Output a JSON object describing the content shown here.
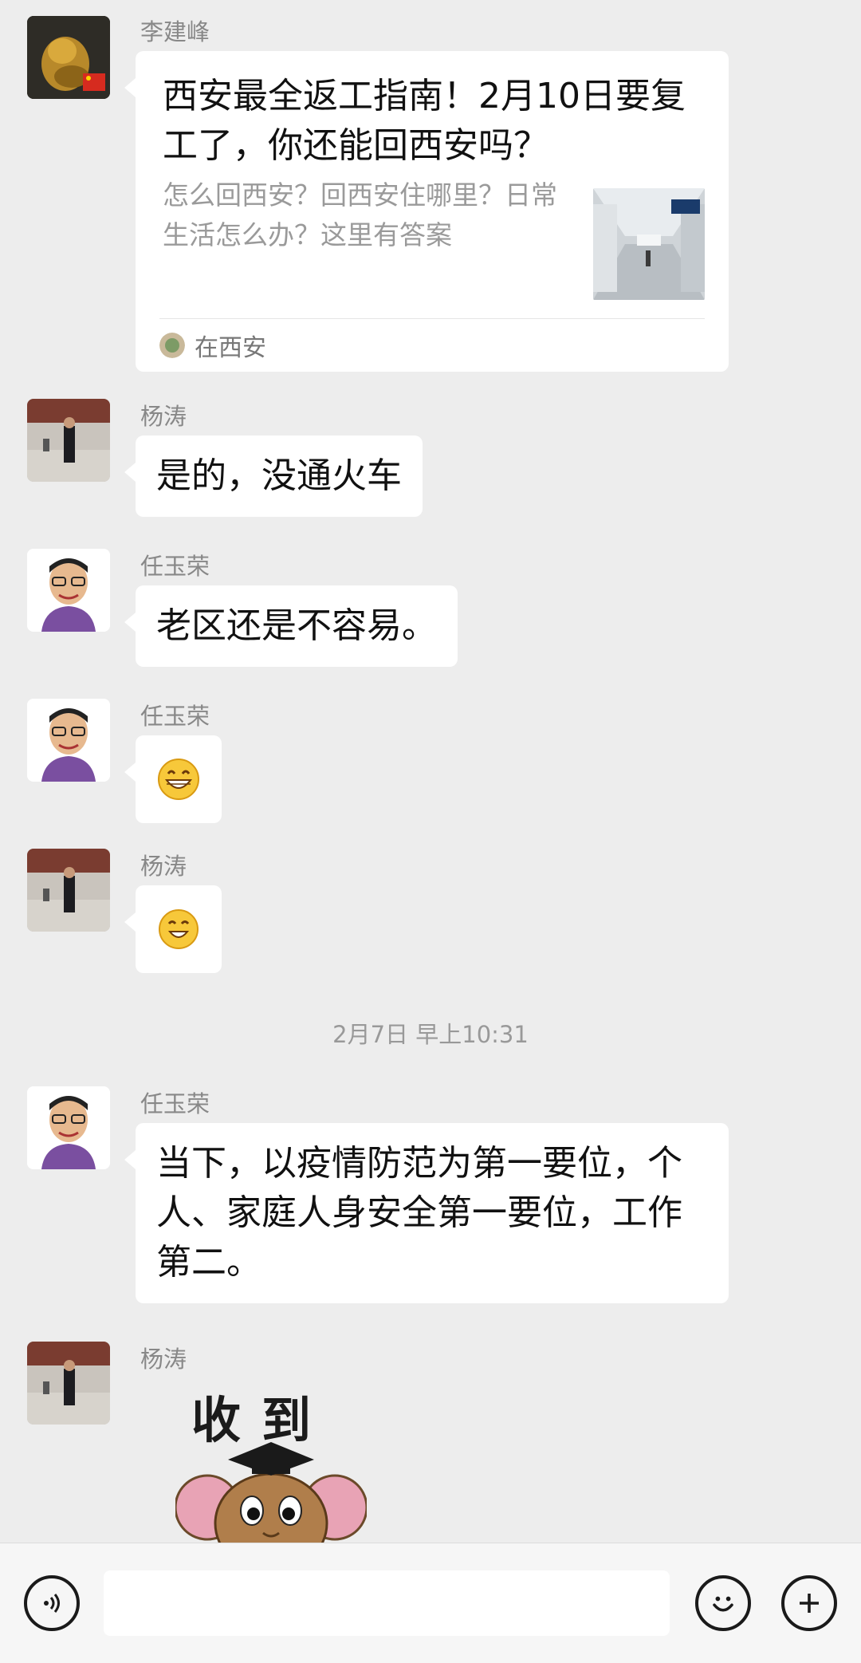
{
  "messages": [
    {
      "sender": "李建峰",
      "type": "link",
      "title": "西安最全返工指南！2月10日要复工了，你还能回西安吗？",
      "description": "怎么回西安？回西安住哪里？日常生活怎么办？这里有答案",
      "source": "在西安"
    },
    {
      "sender": "杨涛",
      "type": "text",
      "text": "是的，没通火车"
    },
    {
      "sender": "任玉荣",
      "type": "text",
      "text": "老区还是不容易。"
    },
    {
      "sender": "任玉荣",
      "type": "emoji",
      "emoji": "grin-face"
    },
    {
      "sender": "杨涛",
      "type": "emoji",
      "emoji": "smile-face"
    },
    {
      "sender": "任玉荣",
      "type": "text",
      "text": "当下，以疫情防范为第一要位，个人、家庭人身安全第一要位，工作第二。"
    },
    {
      "sender": "杨涛",
      "type": "sticker",
      "sticker_text": "收到",
      "sticker": "mouse-graduate-sticker"
    }
  ],
  "timestamp": "2月7日 早上10:31",
  "bottom_bar": {
    "voice_icon": "voice-icon",
    "emoji_icon": "emoji-icon",
    "plus_icon": "plus-icon"
  },
  "colors": {
    "background": "#ededed",
    "bubble": "#ffffff",
    "meta_text": "#888888"
  }
}
